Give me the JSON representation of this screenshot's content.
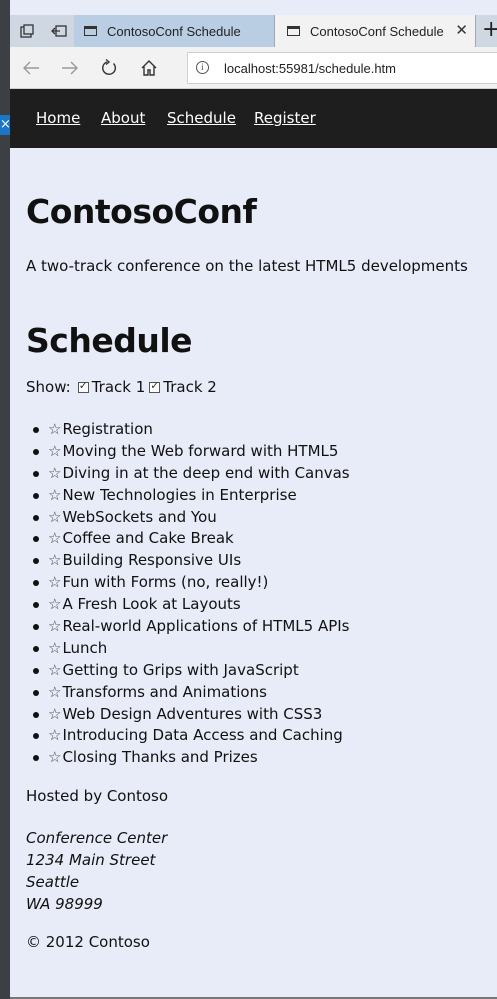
{
  "tabs": [
    {
      "title": "ContosoConf Schedule"
    },
    {
      "title": "ContosoConf Schedule"
    }
  ],
  "address_bar": {
    "url": "localhost:55981/schedule.htm"
  },
  "site_nav": [
    "Home",
    "About",
    "Schedule",
    "Register"
  ],
  "site": {
    "title": "ContosoConf",
    "tagline": "A two-track conference on the latest HTML5 developments"
  },
  "schedule": {
    "heading": "Schedule",
    "show_label": "Show:",
    "filters": [
      {
        "label": "Track 1",
        "checked": true
      },
      {
        "label": "Track 2",
        "checked": true
      }
    ],
    "sessions": [
      "Registration",
      "Moving the Web forward with HTML5",
      "Diving in at the deep end with Canvas",
      "New Technologies in Enterprise",
      "WebSockets and You",
      "Coffee and Cake Break",
      "Building Responsive UIs",
      "Fun with Forms (no, really!)",
      "A Fresh Look at Layouts",
      "Real-world Applications of HTML5 APIs",
      "Lunch",
      "Getting to Grips with JavaScript",
      "Transforms and Animations",
      "Web Design Adventures with CSS3",
      "Introducing Data Access and Caching",
      "Closing Thanks and Prizes"
    ],
    "star_icon": "☆"
  },
  "footer": {
    "hosted_by": "Hosted by Contoso",
    "address_lines": [
      "Conference Center",
      "1234 Main Street",
      "Seattle",
      "WA 98999"
    ],
    "copyright": "© 2012 Contoso"
  },
  "colors": {
    "page_bg": "#e8ecf8",
    "nav_bg": "#1e1e1e",
    "tab_active": "#f2f2f2",
    "tab_inactive": "#b9cde3"
  }
}
